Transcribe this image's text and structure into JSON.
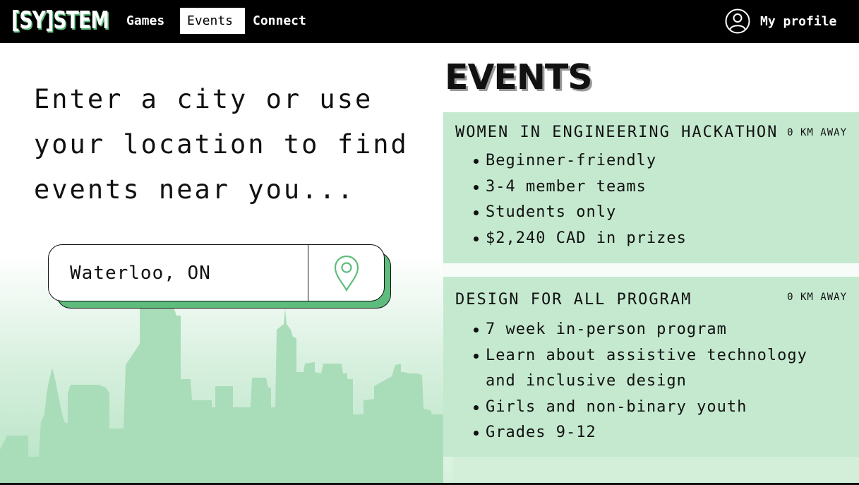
{
  "nav": {
    "logo": "[SY]STEM",
    "items": [
      {
        "label": "Games",
        "active": false
      },
      {
        "label": "Events",
        "active": true
      },
      {
        "label": "Connect",
        "active": false
      }
    ],
    "profile_label": "My profile",
    "profile_icon": "user-circle-icon"
  },
  "search": {
    "prompt": "Enter a city or use your location to find events near you...",
    "value": "Waterloo, ON",
    "locate_icon": "map-pin-icon"
  },
  "events": {
    "heading": "EVENTS",
    "list": [
      {
        "title": "WOMEN IN ENGINEERING HACKATHON",
        "distance": "0 KM AWAY",
        "features": [
          "Beginner-friendly",
          "3-4 member teams",
          "Students only",
          "$2,240 CAD in prizes"
        ]
      },
      {
        "title": "DESIGN FOR ALL PROGRAM",
        "distance": "0 KM AWAY",
        "features": [
          "7 week in-person program",
          "Learn about assistive technology",
          "and inclusive design",
          "Girls and non-binary youth",
          "Grades 9-12"
        ]
      }
    ]
  },
  "colors": {
    "accent_green": "#5ebd7c",
    "card_green": "#c4e9cf",
    "skyline_green": "#a8ddb7",
    "nav_bg": "#000000"
  }
}
